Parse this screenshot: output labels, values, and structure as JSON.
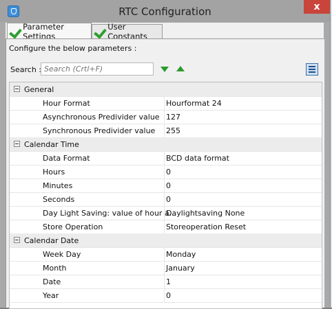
{
  "window": {
    "title": "RTC Configuration",
    "close_glyph": "x"
  },
  "tabs": [
    {
      "label": "Parameter Settings",
      "active": true
    },
    {
      "label": "User Constants",
      "active": false
    }
  ],
  "intro_text": "Configure the below parameters :",
  "search": {
    "label": "Search :",
    "placeholder": "Search (Crtl+F)"
  },
  "groups": [
    {
      "label": "General",
      "rows": [
        {
          "name": "Hour Format",
          "value": "Hourformat 24"
        },
        {
          "name": "Asynchronous Predivider value",
          "value": "127"
        },
        {
          "name": "Synchronous Predivider value",
          "value": "255"
        }
      ]
    },
    {
      "label": "Calendar Time",
      "rows": [
        {
          "name": "Data Format",
          "value": "BCD data format"
        },
        {
          "name": "Hours",
          "value": "0"
        },
        {
          "name": "Minutes",
          "value": "0"
        },
        {
          "name": "Seconds",
          "value": "0"
        },
        {
          "name": "Day Light Saving: value of hour a...",
          "value": "Daylightsaving None"
        },
        {
          "name": "Store Operation",
          "value": "Storeoperation Reset"
        }
      ]
    },
    {
      "label": "Calendar Date",
      "rows": [
        {
          "name": "Week Day",
          "value": "Monday"
        },
        {
          "name": "Month",
          "value": "January"
        },
        {
          "name": "Date",
          "value": "1"
        },
        {
          "name": "Year",
          "value": "0"
        }
      ]
    }
  ],
  "colors": {
    "close_button": "#c9453c",
    "accent_green": "#2d9a2d"
  }
}
